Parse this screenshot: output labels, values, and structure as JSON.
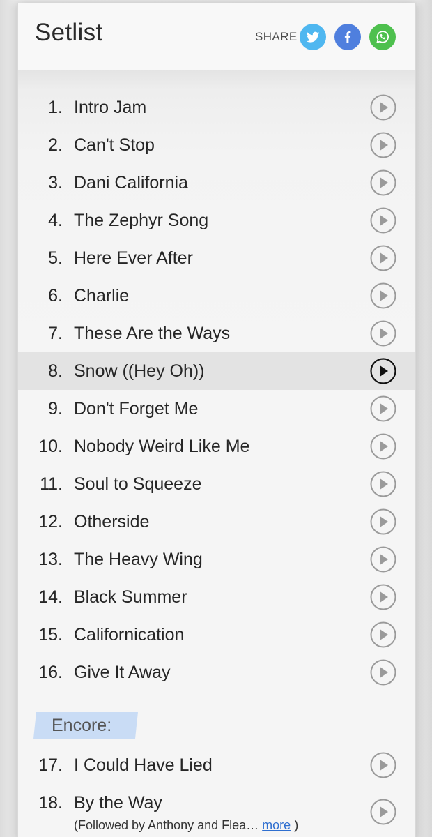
{
  "header": {
    "title": "Setlist",
    "share_label": "SHARE",
    "social": [
      {
        "name": "twitter",
        "icon": "twitter-icon",
        "color": "#4fb7f0"
      },
      {
        "name": "facebook",
        "icon": "facebook-icon",
        "color": "#4f7fde"
      },
      {
        "name": "whatsapp",
        "icon": "whatsapp-icon",
        "color": "#4ec04e"
      }
    ]
  },
  "setlist": {
    "songs": [
      {
        "number": "1.",
        "title": "Intro Jam"
      },
      {
        "number": "2.",
        "title": "Can't Stop"
      },
      {
        "number": "3.",
        "title": "Dani California"
      },
      {
        "number": "4.",
        "title": "The Zephyr Song"
      },
      {
        "number": "5.",
        "title": "Here Ever After"
      },
      {
        "number": "6.",
        "title": "Charlie"
      },
      {
        "number": "7.",
        "title": "These Are the Ways"
      },
      {
        "number": "8.",
        "title": "Snow ((Hey Oh))"
      },
      {
        "number": "9.",
        "title": "Don't Forget Me"
      },
      {
        "number": "10.",
        "title": "Nobody Weird Like Me"
      },
      {
        "number": "11.",
        "title": "Soul to Squeeze"
      },
      {
        "number": "12.",
        "title": "Otherside"
      },
      {
        "number": "13.",
        "title": "The Heavy Wing"
      },
      {
        "number": "14.",
        "title": "Black Summer"
      },
      {
        "number": "15.",
        "title": "Californication"
      },
      {
        "number": "16.",
        "title": "Give It Away"
      }
    ],
    "highlighted_song": "8.",
    "encore_label": "Encore:",
    "encore_songs": [
      {
        "number": "17.",
        "title": "I Could Have Lied"
      },
      {
        "number": "18.",
        "title": "By the Way"
      }
    ],
    "encore_note": "(Followed by Anthony and Flea…",
    "more_link": "more",
    "note_close": ")"
  },
  "colors": {
    "play_icon_default": "#9a9a9a",
    "play_icon_active": "#111111",
    "encore_highlight": "#c9dcf5",
    "link": "#2f6fd0"
  }
}
